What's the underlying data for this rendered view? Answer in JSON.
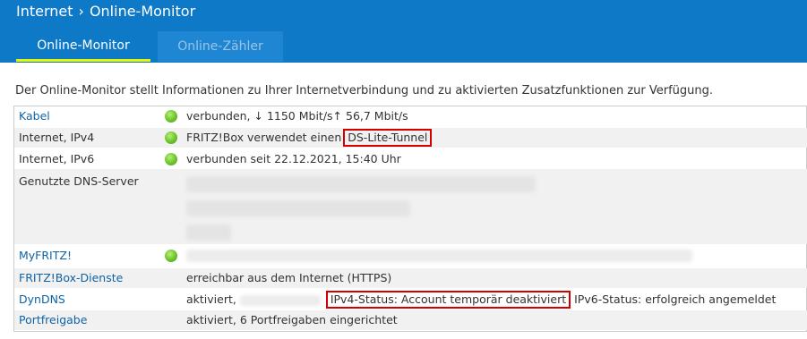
{
  "breadcrumb": {
    "section": "Internet",
    "page": "Online-Monitor"
  },
  "tabs": [
    {
      "label": "Online-Monitor",
      "active": true
    },
    {
      "label": "Online-Zähler",
      "active": false
    }
  ],
  "intro": "Der Online-Monitor stellt Informationen zu Ihrer Internetverbindung und zu aktivierten Zusatzfunktionen zur Verfügung.",
  "rows": {
    "kabel": {
      "label": "Kabel",
      "status": "verbunden, ↓ 1150 Mbit/s↑ 56,7 Mbit/s"
    },
    "ipv4": {
      "label": "Internet, IPv4",
      "status_prefix": "FRITZ!Box verwendet einen",
      "status_highlight": "DS-Lite-Tunnel"
    },
    "ipv6": {
      "label": "Internet, IPv6",
      "status": "verbunden seit 22.12.2021, 15:40 Uhr"
    },
    "dns": {
      "label": "Genutzte DNS-Server"
    },
    "myfritz": {
      "label": "MyFRITZ!"
    },
    "dienste": {
      "label": "FRITZ!Box-Dienste",
      "status": "erreichbar aus dem Internet (HTTPS)"
    },
    "dyndns": {
      "label": "DynDNS",
      "status_prefix": "aktiviert,",
      "status_highlight": "IPv4-Status: Account temporär deaktiviert",
      "status_suffix": "IPv6-Status: erfolgreich angemeldet"
    },
    "portfreigabe": {
      "label": "Portfreigabe",
      "status": "aktiviert, 6 Portfreigaben eingerichtet"
    }
  },
  "colors": {
    "header": "#0e79c6",
    "tab_underline": "#e9f400",
    "link": "#0e63a6",
    "status_ok": "#6cc32a",
    "highlight_box": "#d40000"
  }
}
